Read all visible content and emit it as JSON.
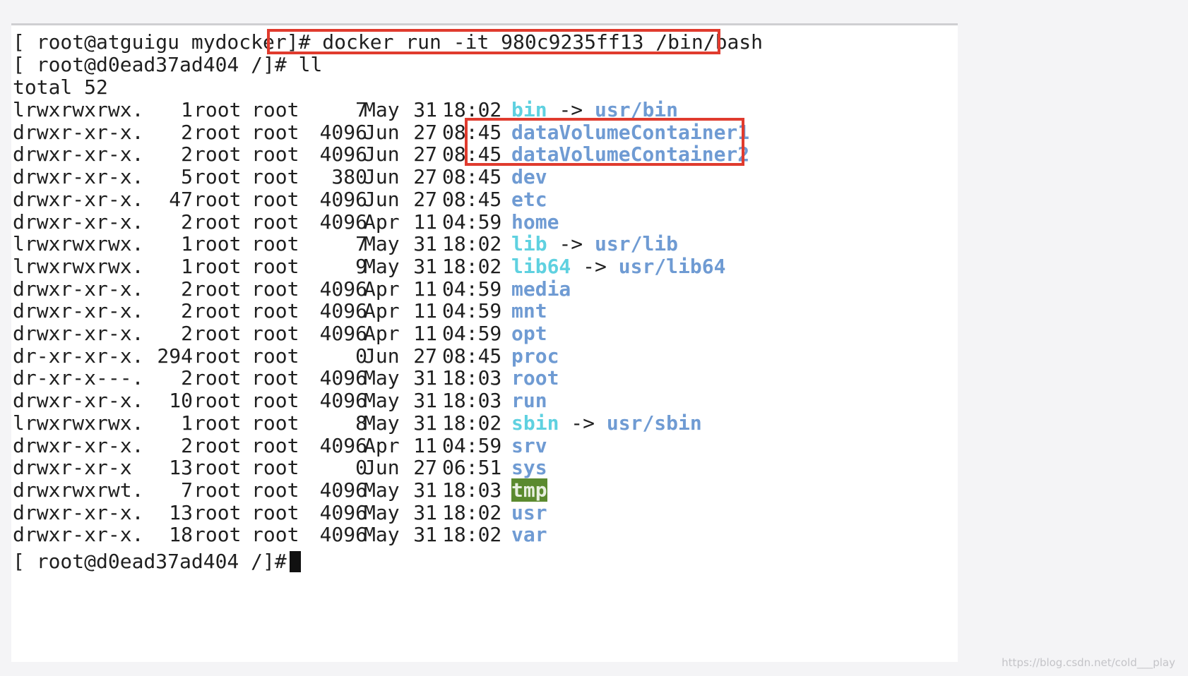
{
  "terminal": {
    "prompt_host": "[ root@atguigu mydocker]#",
    "command_run": "docker run -it 980c9235ff13 /bin/bash",
    "prompt_container": "[ root@d0ead37ad404 /]#",
    "command_ll": "ll",
    "total_line": "total 52",
    "final_prompt": "[ root@d0ead37ad404 /]#",
    "entries": [
      {
        "perm": "lrwxrwxrwx.",
        "links": "1",
        "owner": "root",
        "group": "root",
        "size": "7",
        "mon": "May",
        "day": "31",
        "time": "18:02",
        "name": "bin",
        "arrow": "->",
        "target": "usr/bin"
      },
      {
        "perm": "drwxr-xr-x.",
        "links": "2",
        "owner": "root",
        "group": "root",
        "size": "4096",
        "mon": "Jun",
        "day": "27",
        "time": "08:45",
        "name": "dataVolumeContainer1"
      },
      {
        "perm": "drwxr-xr-x.",
        "links": "2",
        "owner": "root",
        "group": "root",
        "size": "4096",
        "mon": "Jun",
        "day": "27",
        "time": "08:45",
        "name": "dataVolumeContainer2"
      },
      {
        "perm": "drwxr-xr-x.",
        "links": "5",
        "owner": "root",
        "group": "root",
        "size": "380",
        "mon": "Jun",
        "day": "27",
        "time": "08:45",
        "name": "dev"
      },
      {
        "perm": "drwxr-xr-x.",
        "links": "47",
        "owner": "root",
        "group": "root",
        "size": "4096",
        "mon": "Jun",
        "day": "27",
        "time": "08:45",
        "name": "etc"
      },
      {
        "perm": "drwxr-xr-x.",
        "links": "2",
        "owner": "root",
        "group": "root",
        "size": "4096",
        "mon": "Apr",
        "day": "11",
        "time": "04:59",
        "name": "home"
      },
      {
        "perm": "lrwxrwxrwx.",
        "links": "1",
        "owner": "root",
        "group": "root",
        "size": "7",
        "mon": "May",
        "day": "31",
        "time": "18:02",
        "name": "lib",
        "arrow": "->",
        "target": "usr/lib"
      },
      {
        "perm": "lrwxrwxrwx.",
        "links": "1",
        "owner": "root",
        "group": "root",
        "size": "9",
        "mon": "May",
        "day": "31",
        "time": "18:02",
        "name": "lib64",
        "arrow": "->",
        "target": "usr/lib64"
      },
      {
        "perm": "drwxr-xr-x.",
        "links": "2",
        "owner": "root",
        "group": "root",
        "size": "4096",
        "mon": "Apr",
        "day": "11",
        "time": "04:59",
        "name": "media"
      },
      {
        "perm": "drwxr-xr-x.",
        "links": "2",
        "owner": "root",
        "group": "root",
        "size": "4096",
        "mon": "Apr",
        "day": "11",
        "time": "04:59",
        "name": "mnt"
      },
      {
        "perm": "drwxr-xr-x.",
        "links": "2",
        "owner": "root",
        "group": "root",
        "size": "4096",
        "mon": "Apr",
        "day": "11",
        "time": "04:59",
        "name": "opt"
      },
      {
        "perm": "dr-xr-xr-x.",
        "links": "294",
        "owner": "root",
        "group": "root",
        "size": "0",
        "mon": "Jun",
        "day": "27",
        "time": "08:45",
        "name": "proc"
      },
      {
        "perm": "dr-xr-x---.",
        "links": "2",
        "owner": "root",
        "group": "root",
        "size": "4096",
        "mon": "May",
        "day": "31",
        "time": "18:03",
        "name": "root"
      },
      {
        "perm": "drwxr-xr-x.",
        "links": "10",
        "owner": "root",
        "group": "root",
        "size": "4096",
        "mon": "May",
        "day": "31",
        "time": "18:03",
        "name": "run"
      },
      {
        "perm": "lrwxrwxrwx.",
        "links": "1",
        "owner": "root",
        "group": "root",
        "size": "8",
        "mon": "May",
        "day": "31",
        "time": "18:02",
        "name": "sbin",
        "arrow": "->",
        "target": "usr/sbin"
      },
      {
        "perm": "drwxr-xr-x.",
        "links": "2",
        "owner": "root",
        "group": "root",
        "size": "4096",
        "mon": "Apr",
        "day": "11",
        "time": "04:59",
        "name": "srv"
      },
      {
        "perm": "drwxr-xr-x",
        "links": "13",
        "owner": "root",
        "group": "root",
        "size": "0",
        "mon": "Jun",
        "day": "27",
        "time": "06:51",
        "name": "sys"
      },
      {
        "perm": "drwxrwxrwt.",
        "links": "7",
        "owner": "root",
        "group": "root",
        "size": "4096",
        "mon": "May",
        "day": "31",
        "time": "18:03",
        "name": "tmp"
      },
      {
        "perm": "drwxr-xr-x.",
        "links": "13",
        "owner": "root",
        "group": "root",
        "size": "4096",
        "mon": "May",
        "day": "31",
        "time": "18:02",
        "name": "usr"
      },
      {
        "perm": "drwxr-xr-x.",
        "links": "18",
        "owner": "root",
        "group": "root",
        "size": "4096",
        "mon": "May",
        "day": "31",
        "time": "18:02",
        "name": "var"
      }
    ]
  },
  "watermark": "https://blog.csdn.net/cold___play"
}
